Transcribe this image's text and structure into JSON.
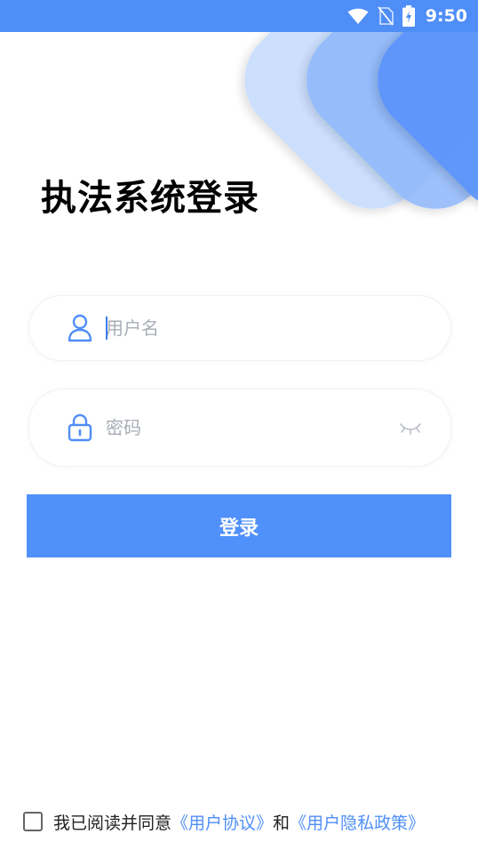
{
  "status_bar": {
    "time": "9:50",
    "icons": [
      "wifi-icon",
      "no-sim-icon",
      "battery-charging-icon"
    ]
  },
  "page": {
    "title": "执法系统登录"
  },
  "username": {
    "placeholder": "用户名",
    "value": "",
    "icon": "user-icon"
  },
  "password": {
    "placeholder": "密码",
    "value": "",
    "icon": "lock-icon",
    "toggle_icon": "eye-closed-icon"
  },
  "login_button": {
    "label": "登录"
  },
  "agreement": {
    "checked": false,
    "prefix": "我已阅读并同意",
    "user_agreement": "《用户协议》",
    "conjunction": "和",
    "privacy_policy": "《用户隐私政策》"
  },
  "colors": {
    "primary": "#4f8ef7",
    "button": "#5090fb",
    "placeholder": "#a8adb6"
  }
}
